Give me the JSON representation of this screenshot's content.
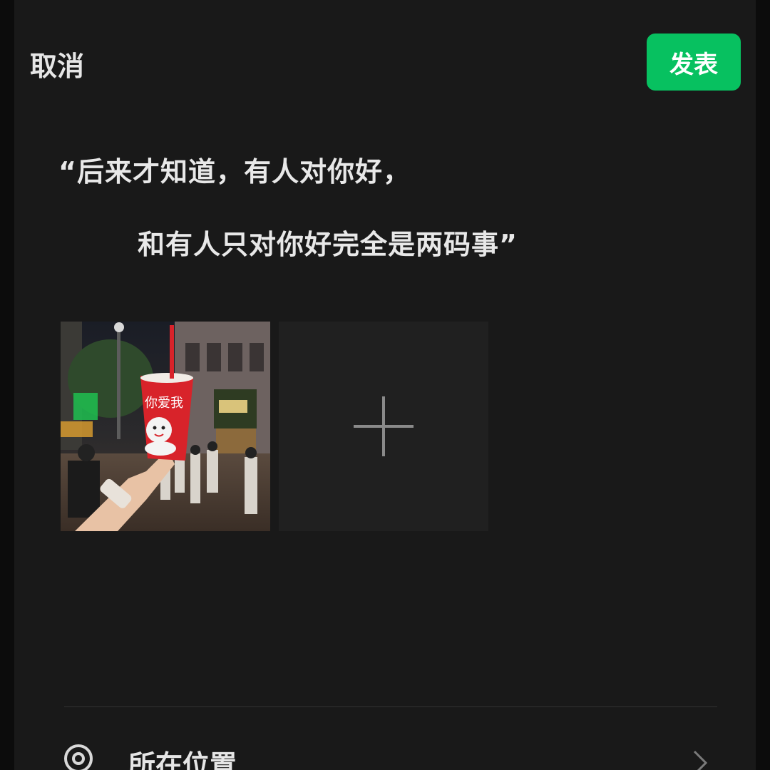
{
  "header": {
    "cancel_label": "取消",
    "publish_label": "发表",
    "publish_color": "#07c160"
  },
  "post": {
    "line1": "“后来才知道，有人对你好，",
    "line2": "和有人只对你好完全是两码事”"
  },
  "photos": {
    "thumbnail_icon": "photo-thumbnail",
    "cup_text": "你爱我",
    "add_icon": "plus-icon"
  },
  "location": {
    "icon": "location-pin-icon",
    "label": "所在位置",
    "chevron": "chevron-right-icon"
  }
}
